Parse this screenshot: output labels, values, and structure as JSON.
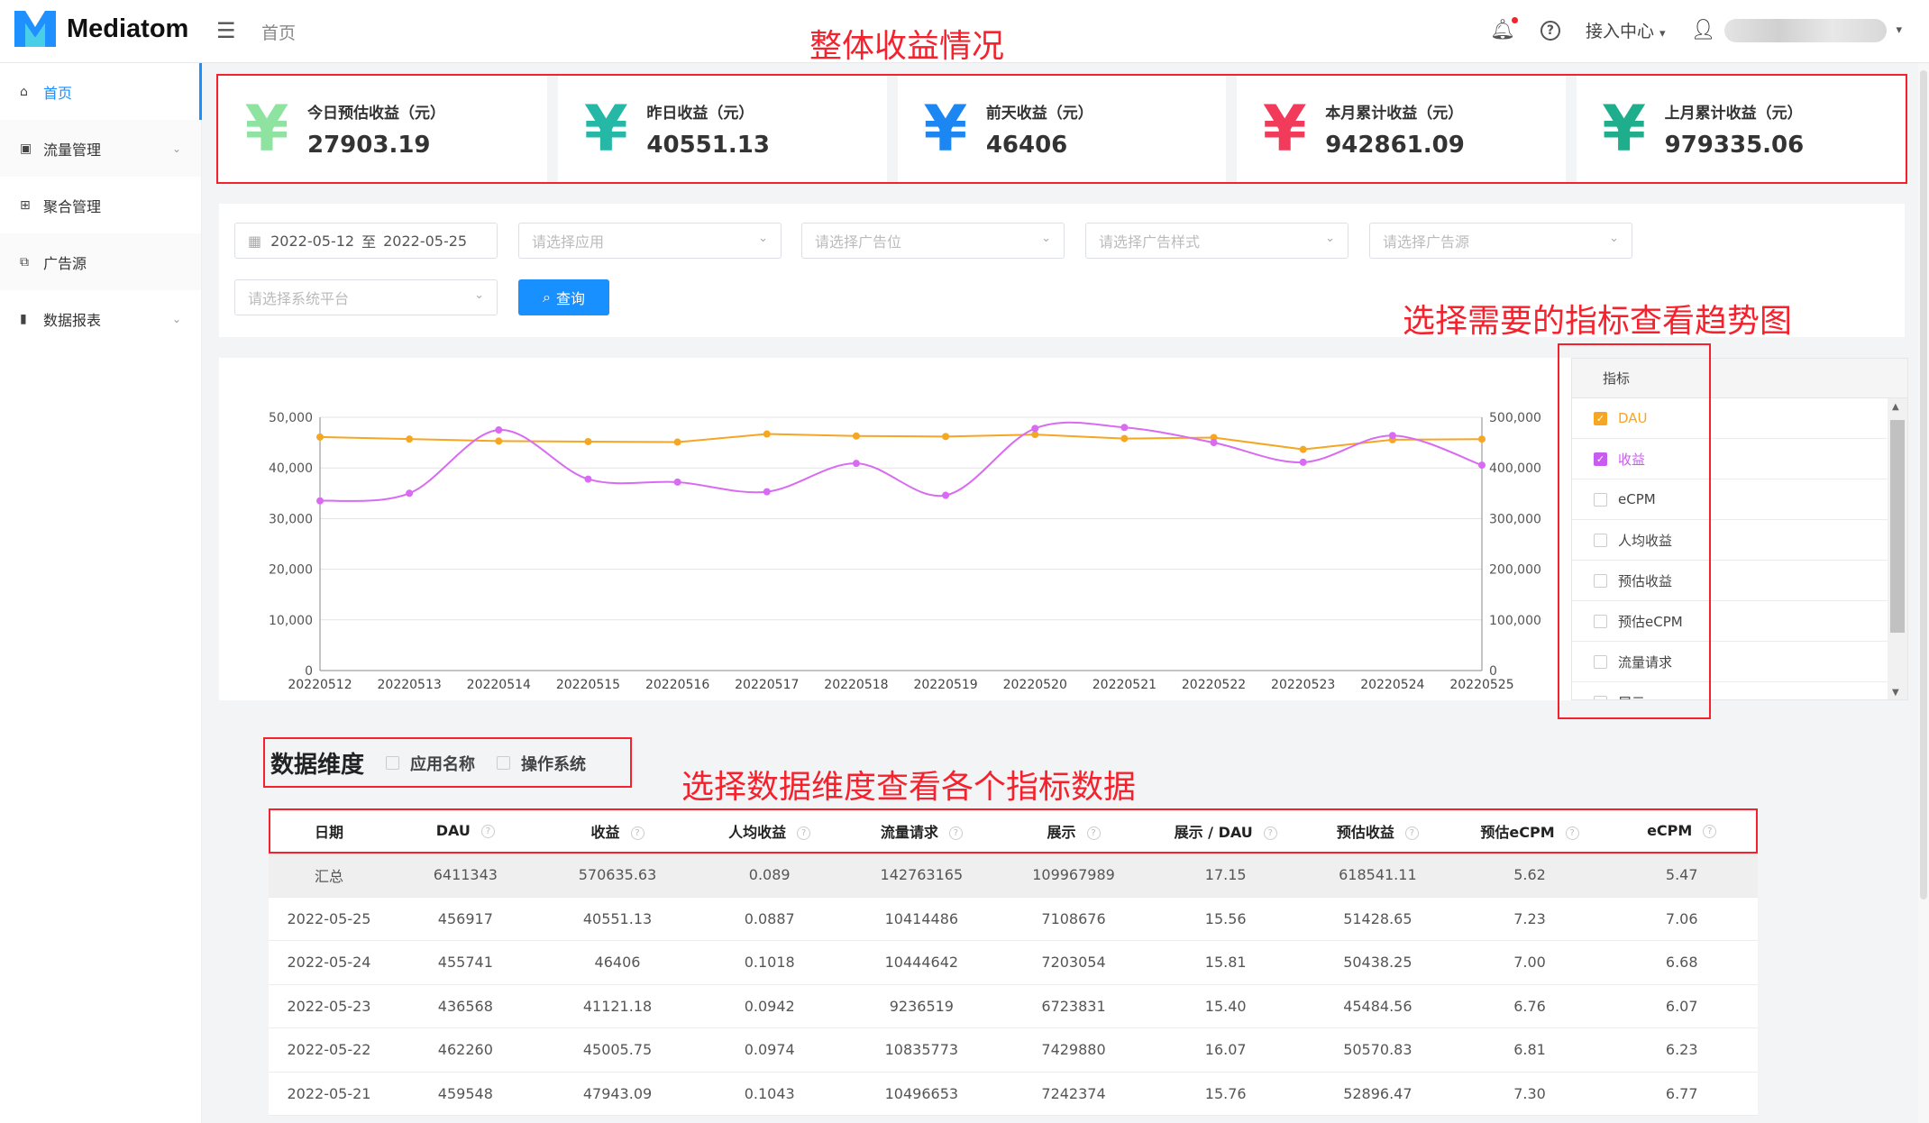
{
  "app": {
    "name": "Mediatom",
    "breadcrumb": "首页"
  },
  "header": {
    "access_center": "接入中心"
  },
  "annotations": {
    "overall": "整体收益情况",
    "select_metric": "选择需要的指标查看趋势图",
    "select_dimension": "选择数据维度查看各个指标数据"
  },
  "sidebar": {
    "items": [
      {
        "label": "首页",
        "icon": "home-icon",
        "active": true
      },
      {
        "label": "流量管理",
        "icon": "traffic-icon",
        "expand": true
      },
      {
        "label": "聚合管理",
        "icon": "aggregate-icon"
      },
      {
        "label": "广告源",
        "icon": "ad-source-icon"
      },
      {
        "label": "数据报表",
        "icon": "report-icon",
        "expand": true
      }
    ]
  },
  "stats": [
    {
      "label": "今日预估收益（元）",
      "value": "27903.19",
      "color": "#8ee3a0"
    },
    {
      "label": "昨日收益（元）",
      "value": "40551.13",
      "color": "#25b8a6"
    },
    {
      "label": "前天收益（元）",
      "value": "46406",
      "color": "#1c86f2"
    },
    {
      "label": "本月累计收益（元）",
      "value": "942861.09",
      "color": "#f23a5a"
    },
    {
      "label": "上月累计收益（元）",
      "value": "979335.06",
      "color": "#1fae8c"
    }
  ],
  "filters": {
    "date_start": "2022-05-12",
    "date_sep": "至",
    "date_end": "2022-05-25",
    "app_placeholder": "请选择应用",
    "slot_placeholder": "请选择广告位",
    "style_placeholder": "请选择广告样式",
    "source_placeholder": "请选择广告源",
    "platform_placeholder": "请选择系统平台",
    "query_label": "查询"
  },
  "metrics_panel": {
    "header": "指标",
    "items": [
      {
        "label": "DAU",
        "checked": true,
        "color": "#f5a623"
      },
      {
        "label": "收益",
        "checked": true,
        "color": "#c95cf0"
      },
      {
        "label": "eCPM",
        "checked": false
      },
      {
        "label": "人均收益",
        "checked": false
      },
      {
        "label": "预估收益",
        "checked": false
      },
      {
        "label": "预估eCPM",
        "checked": false
      },
      {
        "label": "流量请求",
        "checked": false
      },
      {
        "label": "展示",
        "checked": false
      }
    ]
  },
  "chart_data": {
    "type": "line",
    "x": [
      "20220512",
      "20220513",
      "20220514",
      "20220515",
      "20220516",
      "20220517",
      "20220518",
      "20220519",
      "20220520",
      "20220521",
      "20220522",
      "20220523",
      "20220524",
      "20220525"
    ],
    "left_ticks": [
      "0",
      "10,000",
      "20,000",
      "30,000",
      "40,000",
      "50,000"
    ],
    "right_ticks": [
      "0",
      "100,000",
      "200,000",
      "300,000",
      "400,000",
      "500,000"
    ],
    "ylim_left": [
      0,
      50000
    ],
    "ylim_right": [
      0,
      500000
    ],
    "grid": true,
    "series": [
      {
        "name": "DAU",
        "axis": "right",
        "color": "#f5a623",
        "smooth": false,
        "values": [
          461000,
          457000,
          453000,
          452000,
          451000,
          467000,
          463000,
          462000,
          466000,
          458000,
          460000,
          436568,
          455741,
          456917
        ]
      },
      {
        "name": "收益",
        "axis": "left",
        "color": "#d86bf2",
        "smooth": true,
        "values": [
          33500,
          35000,
          47500,
          37800,
          37200,
          35300,
          40900,
          34600,
          47800,
          48000,
          45000,
          41121.18,
          46406,
          40551.13
        ]
      }
    ]
  },
  "dimension": {
    "title": "数据维度",
    "options": [
      "应用名称",
      "操作系统"
    ]
  },
  "table": {
    "columns": [
      "日期",
      "DAU",
      "收益",
      "人均收益",
      "流量请求",
      "展示",
      "展示 / DAU",
      "预估收益",
      "预估eCPM",
      "eCPM"
    ],
    "help_cols": [
      false,
      true,
      true,
      true,
      true,
      true,
      true,
      true,
      true,
      true
    ],
    "rows": [
      [
        "汇总",
        "6411343",
        "570635.63",
        "0.089",
        "142763165",
        "109967989",
        "17.15",
        "618541.11",
        "5.62",
        "5.47"
      ],
      [
        "2022-05-25",
        "456917",
        "40551.13",
        "0.0887",
        "10414486",
        "7108676",
        "15.56",
        "51428.65",
        "7.23",
        "7.06"
      ],
      [
        "2022-05-24",
        "455741",
        "46406",
        "0.1018",
        "10444642",
        "7203054",
        "15.81",
        "50438.25",
        "7.00",
        "6.68"
      ],
      [
        "2022-05-23",
        "436568",
        "41121.18",
        "0.0942",
        "9236519",
        "6723831",
        "15.40",
        "45484.56",
        "6.76",
        "6.07"
      ],
      [
        "2022-05-22",
        "462260",
        "45005.75",
        "0.0974",
        "10835773",
        "7429880",
        "16.07",
        "50570.83",
        "6.81",
        "6.23"
      ],
      [
        "2022-05-21",
        "459548",
        "47943.09",
        "0.1043",
        "10496653",
        "7242374",
        "15.76",
        "52896.47",
        "7.30",
        "6.77"
      ]
    ]
  }
}
